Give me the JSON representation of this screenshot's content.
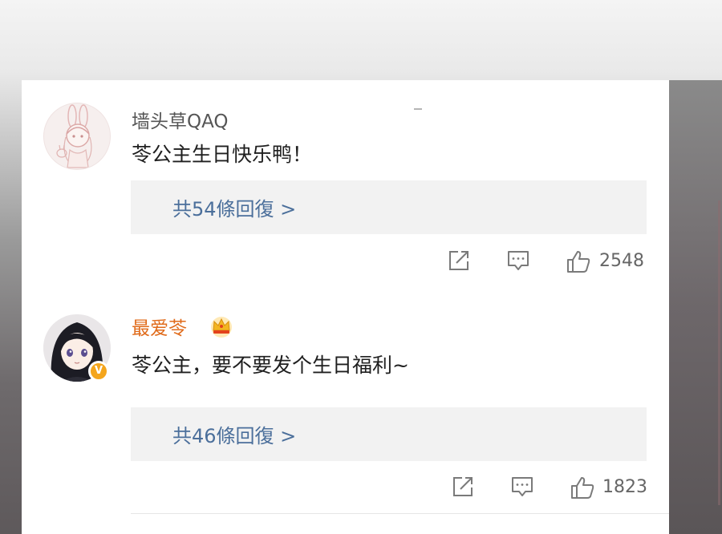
{
  "comments": [
    {
      "username": "墙头草QAQ",
      "text": "苓公主生日快乐鸭！",
      "replies_label": "共54條回復 >",
      "likes": "2548"
    },
    {
      "username": "最爱苓",
      "text": "苓公主，要不要发个生日福利~",
      "replies_label": "共46條回復 >",
      "likes": "1823",
      "verified_badge": "V"
    }
  ],
  "colors": {
    "username_vip": "#e06b1b",
    "reply_link": "#4b6f9b",
    "badge": "#f4a51c"
  },
  "icons": [
    "share-icon",
    "comment-icon",
    "thumbs-up-icon",
    "crown-icon"
  ]
}
